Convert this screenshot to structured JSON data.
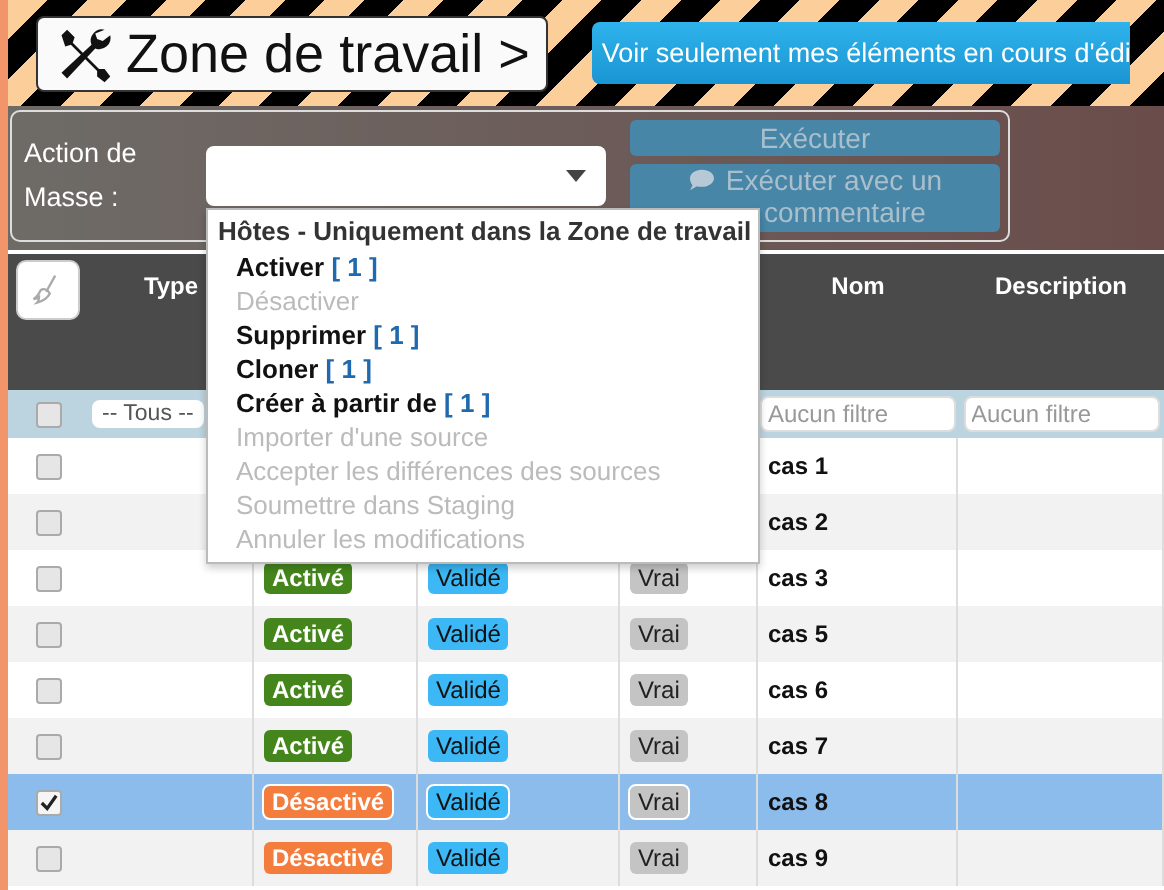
{
  "title": "Zone de travail >",
  "edit_filter_button": "Voir seulement mes éléments en cours d'édi",
  "mass_action": {
    "label": "Action de Masse :",
    "execute": "Exécuter",
    "execute_comment": [
      "Exécuter avec un",
      "commentaire"
    ]
  },
  "dropdown": {
    "group": "Hôtes - Uniquement dans la Zone de travail",
    "items": [
      {
        "label": "Activer",
        "count": "[ 1 ]",
        "disabled": false
      },
      {
        "label": "Désactiver",
        "disabled": true
      },
      {
        "label": "Supprimer",
        "count": "[ 1 ]",
        "disabled": false
      },
      {
        "label": "Cloner",
        "count": "[ 1 ]",
        "disabled": false
      },
      {
        "label": "Créer à partir de",
        "count": "[ 1 ]",
        "disabled": false
      },
      {
        "label": "Importer d'une source",
        "disabled": true
      },
      {
        "label": "Accepter les différences des sources",
        "disabled": true
      },
      {
        "label": "Soumettre dans Staging",
        "disabled": true
      },
      {
        "label": "Annuler les modifications",
        "disabled": true
      }
    ]
  },
  "table": {
    "columns": {
      "type": "Type",
      "name": "Nom",
      "description": "Description"
    },
    "filters": {
      "select_all_checked": false,
      "type": "-- Tous --",
      "name_placeholder": "Aucun filtre",
      "description_placeholder": "Aucun filtre"
    },
    "rows": [
      {
        "checked": false,
        "selected": false,
        "name": "cas 1"
      },
      {
        "checked": false,
        "selected": false,
        "name": "cas 2"
      },
      {
        "checked": false,
        "selected": false,
        "status": {
          "label": "Activé",
          "kind": "enabled"
        },
        "validation": "Validé",
        "flag": "Vrai",
        "name": "cas 3"
      },
      {
        "checked": false,
        "selected": false,
        "status": {
          "label": "Activé",
          "kind": "enabled"
        },
        "validation": "Validé",
        "flag": "Vrai",
        "name": "cas 5"
      },
      {
        "checked": false,
        "selected": false,
        "status": {
          "label": "Activé",
          "kind": "enabled"
        },
        "validation": "Validé",
        "flag": "Vrai",
        "name": "cas 6"
      },
      {
        "checked": false,
        "selected": false,
        "status": {
          "label": "Activé",
          "kind": "enabled"
        },
        "validation": "Validé",
        "flag": "Vrai",
        "name": "cas 7"
      },
      {
        "checked": true,
        "selected": true,
        "status": {
          "label": "Désactivé",
          "kind": "disabled"
        },
        "validation": "Validé",
        "flag": "Vrai",
        "name": "cas 8"
      },
      {
        "checked": false,
        "selected": false,
        "status": {
          "label": "Désactivé",
          "kind": "disabled"
        },
        "validation": "Validé",
        "flag": "Vrai",
        "name": "cas 9"
      }
    ]
  }
}
